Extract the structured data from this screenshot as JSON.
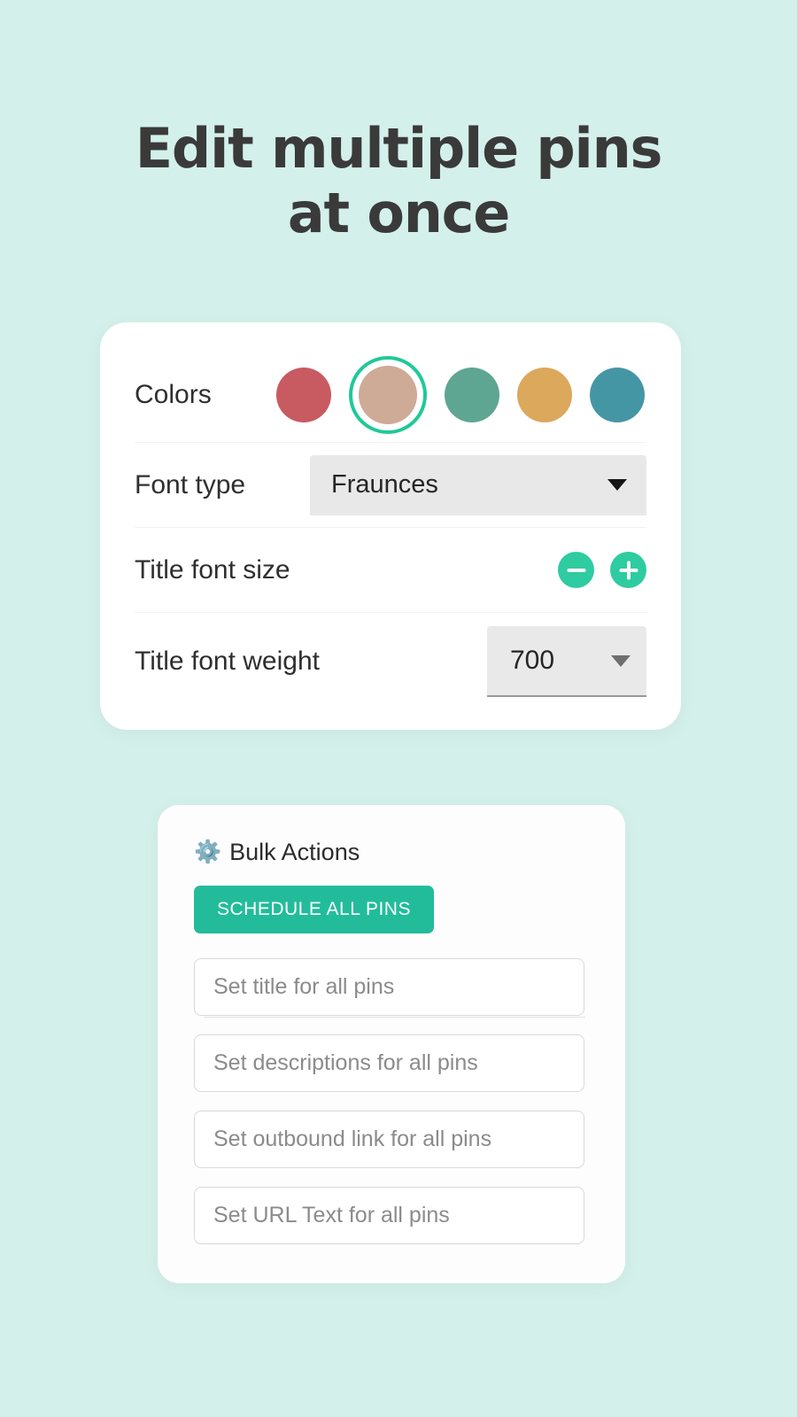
{
  "theme": {
    "background": "#d4f0ea",
    "card_background": "#ffffff",
    "accent_teal": "#2ecca0",
    "button_teal": "#22bc9b",
    "selected_ring": "#20c997",
    "heading_color": "#3a3a3a"
  },
  "headline": {
    "line1": "Edit multiple pins",
    "line2": "at once"
  },
  "settings": {
    "colors": {
      "label": "Colors",
      "swatches": [
        {
          "name": "swatch-red",
          "hex": "#c85a62",
          "selected": false
        },
        {
          "name": "swatch-tan",
          "hex": "#cdab97",
          "selected": true
        },
        {
          "name": "swatch-green",
          "hex": "#5ea592",
          "selected": false
        },
        {
          "name": "swatch-gold",
          "hex": "#dba85c",
          "selected": false
        },
        {
          "name": "swatch-blue",
          "hex": "#4596a5",
          "selected": false
        }
      ]
    },
    "font_type": {
      "label": "Font type",
      "value": "Fraunces"
    },
    "title_font_size": {
      "label": "Title font size",
      "decrement_label": "−",
      "increment_label": "+"
    },
    "title_font_weight": {
      "label": "Title font weight",
      "value": "700"
    }
  },
  "bulk_actions": {
    "icon": "gear-icon",
    "icon_glyph": "⚙️",
    "title": "Bulk Actions",
    "schedule_button": "SCHEDULE ALL PINS",
    "fields": [
      {
        "name": "set-title-input",
        "placeholder": "Set title for all pins"
      },
      {
        "name": "set-descriptions-input",
        "placeholder": "Set descriptions for all pins"
      },
      {
        "name": "set-outbound-link-input",
        "placeholder": "Set outbound link for all pins"
      },
      {
        "name": "set-url-text-input",
        "placeholder": "Set URL Text for all pins"
      }
    ]
  }
}
